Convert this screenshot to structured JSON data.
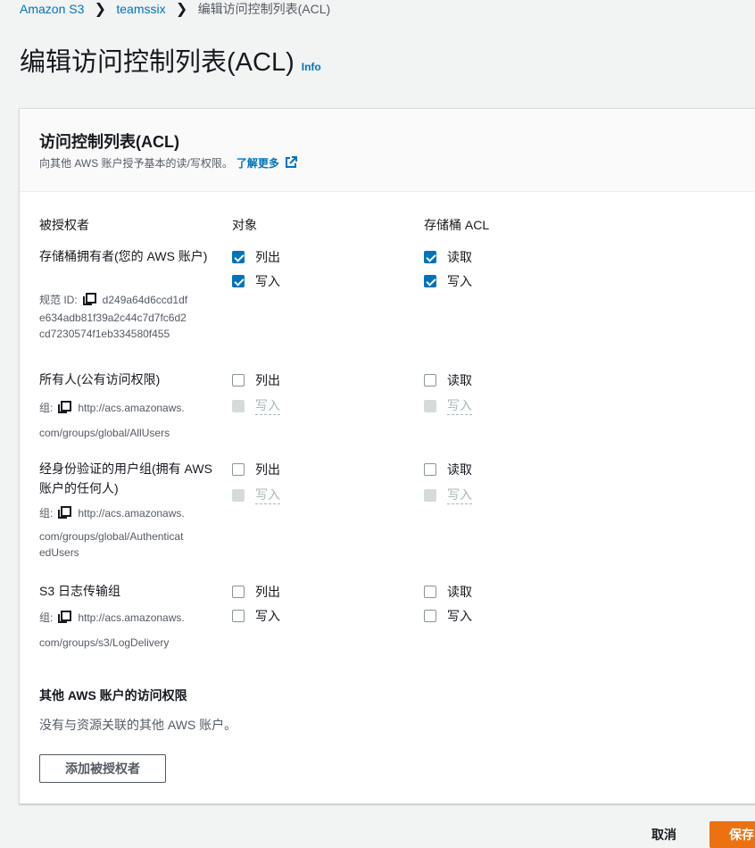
{
  "breadcrumb": {
    "items": [
      "Amazon S3",
      "teamssix"
    ],
    "separator": "❯",
    "current": "编辑访问控制列表(ACL)"
  },
  "page": {
    "title": "编辑访问控制列表(ACL)",
    "info": "Info"
  },
  "panel": {
    "title": "访问控制列表(ACL)",
    "description": "向其他 AWS 账户授予基本的读/写权限。",
    "learn_more": "了解更多"
  },
  "columns": {
    "grantee": "被授权者",
    "objects": "对象",
    "bucket_acl": "存储桶 ACL"
  },
  "grantees": [
    {
      "name": "存储桶拥有者(您的 AWS 账户)",
      "id_label": "规范 ID:",
      "id_value": "d249a64d6ccd1dfe634adb81f39a2c44c7d7fc6d2cd7230574f1eb334580f455",
      "id_lines": [
        "d249a64d6ccd1df",
        "e634adb81f39a2c44c7d7fc6d2",
        "cd7230574f1eb334580f455"
      ],
      "objects": [
        {
          "label": "列出",
          "state": "checked"
        },
        {
          "label": "写入",
          "state": "checked"
        }
      ],
      "bucket": [
        {
          "label": "读取",
          "state": "checked"
        },
        {
          "label": "写入",
          "state": "checked"
        }
      ]
    },
    {
      "name": "所有人(公有访问权限)",
      "id_label": "组:",
      "id_lines": [
        "http://acs.amazonaws.",
        "com/groups/global/AllUsers"
      ],
      "objects": [
        {
          "label": "列出",
          "state": "unchecked"
        },
        {
          "label": "写入",
          "state": "disabled"
        }
      ],
      "bucket": [
        {
          "label": "读取",
          "state": "unchecked"
        },
        {
          "label": "写入",
          "state": "disabled"
        }
      ]
    },
    {
      "name": "经身份验证的用户组(拥有 AWS 账户的任何人)",
      "id_label": "组:",
      "id_lines": [
        "http://acs.amazonaws.",
        "com/groups/global/Authenticat",
        "edUsers"
      ],
      "objects": [
        {
          "label": "列出",
          "state": "unchecked"
        },
        {
          "label": "写入",
          "state": "disabled"
        }
      ],
      "bucket": [
        {
          "label": "读取",
          "state": "unchecked"
        },
        {
          "label": "写入",
          "state": "disabled"
        }
      ]
    },
    {
      "name": "S3 日志传输组",
      "id_label": "组:",
      "id_lines": [
        "http://acs.amazonaws.",
        "com/groups/s3/LogDelivery"
      ],
      "objects": [
        {
          "label": "列出",
          "state": "unchecked"
        },
        {
          "label": "写入",
          "state": "unchecked"
        }
      ],
      "bucket": [
        {
          "label": "读取",
          "state": "unchecked"
        },
        {
          "label": "写入",
          "state": "unchecked"
        }
      ]
    }
  ],
  "other_accounts": {
    "title": "其他 AWS 账户的访问权限",
    "empty": "没有与资源关联的其他 AWS 账户。",
    "add_button": "添加被授权者"
  },
  "footer": {
    "cancel": "取消",
    "save": "保存"
  },
  "colors": {
    "link": "#0073bb",
    "primary": "#ec7211",
    "checkbox": "#0073bb"
  }
}
